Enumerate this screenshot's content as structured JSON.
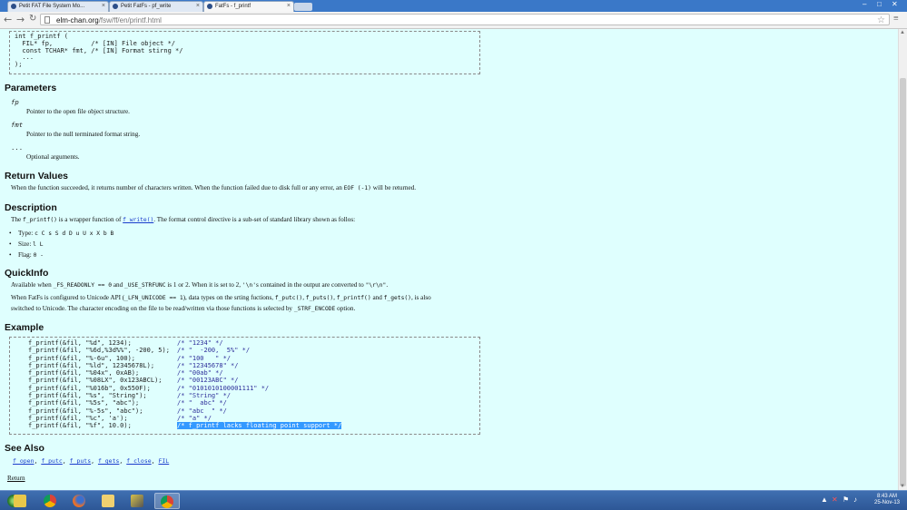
{
  "browser": {
    "tabs": [
      {
        "label": "Petit FAT File System Mo..."
      },
      {
        "label": "Petit FatFs - pf_write"
      },
      {
        "label": "FatFs - f_printf"
      }
    ],
    "url_host": "elm-chan.org",
    "url_path": "/fsw/ff/en/printf.html"
  },
  "prototype": {
    "lines": [
      "int f_printf (",
      "  FIL* fp,          /* [IN] File object */",
      "  const TCHAR* fmt, /* [IN] Format stirng */",
      "  ...",
      ");"
    ]
  },
  "parameters": {
    "heading": "Parameters",
    "items": [
      {
        "term": "fp",
        "desc": "Pointer to the open file object structure."
      },
      {
        "term": "fmt",
        "desc": "Pointer to the null terminated format string."
      },
      {
        "term": "...",
        "desc": "Optional arguments."
      }
    ]
  },
  "return_values": {
    "heading": "Return Values",
    "text_a": "When the function succeeded, it returns number of characters written. When the function failed due to disk full or any error, an",
    "code": "EOF (-1)",
    "text_b": "will be returned."
  },
  "description": {
    "heading": "Description",
    "text_a": "The",
    "code_a": "f_printf()",
    "text_b": "is a wrapper function of",
    "link": "f_write()",
    "text_c": ". The format control directive is a sub-set of standard library shown as follos:",
    "bullets": [
      {
        "label": "Type:",
        "value": "c C s S d D u U x X b B"
      },
      {
        "label": "Size:",
        "value": "l L"
      },
      {
        "label": "Flag:",
        "value": "0 -"
      }
    ]
  },
  "quickinfo": {
    "heading": "QuickInfo",
    "l1": [
      "Available when",
      "_FS_READONLY == 0",
      "and",
      "_USE_STRFUNC",
      "is 1 or 2. When it is set to 2,",
      "'\\n'",
      "s contained in the output are converted to",
      "\"\\r\\n\"",
      "."
    ],
    "l2": [
      "When FatFs is configured to Unicode API (",
      "_LFN_UNICODE == 1",
      "), data types on the srting fuctions,",
      "f_putc()",
      ",",
      "f_puts()",
      ",",
      "f_printf()",
      "and",
      "f_gets()",
      ", is also"
    ],
    "l3": [
      "switched to Unicode. The character encoding on the file to be read/written via those functions is selected by",
      "_STRF_ENCODE",
      "option."
    ]
  },
  "example": {
    "heading": "Example",
    "rows": [
      {
        "code": "f_printf(&fil, \"%d\", 1234);",
        "comment": "/* \"1234\" */"
      },
      {
        "code": "f_printf(&fil, \"%6d,%3d%%\", -200, 5);",
        "comment": "/* \"  -200,  5%\" */"
      },
      {
        "code": "f_printf(&fil, \"%-6u\", 100);",
        "comment": "/* \"100   \" */"
      },
      {
        "code": "f_printf(&fil, \"%ld\", 12345678L);",
        "comment": "/* \"12345678\" */"
      },
      {
        "code": "f_printf(&fil, \"%04x\", 0xAB);",
        "comment": "/* \"00ab\" */"
      },
      {
        "code": "f_printf(&fil, \"%08LX\", 0x123ABCL);",
        "comment": "/* \"00123ABC\" */"
      },
      {
        "code": "f_printf(&fil, \"%016b\", 0x550F);",
        "comment": "/* \"0101010100001111\" */"
      },
      {
        "code": "f_printf(&fil, \"%s\", \"String\");",
        "comment": "/* \"String\" */"
      },
      {
        "code": "f_printf(&fil, \"%5s\", \"abc\");",
        "comment": "/* \"  abc\" */"
      },
      {
        "code": "f_printf(&fil, \"%-5s\", \"abc\");",
        "comment": "/* \"abc  \" */"
      },
      {
        "code": "f_printf(&fil, \"%c\", 'a');",
        "comment": "/* \"a\" */"
      },
      {
        "code": "f_printf(&fil, \"%f\", 10.0);",
        "comment": "/* f_printf lacks floating point support */"
      }
    ]
  },
  "see_also": {
    "heading": "See Also",
    "links": [
      "f_open",
      "f_putc",
      "f_puts",
      "f_gets",
      "f_close",
      "FIL"
    ]
  },
  "return_link": "Return",
  "taskbar": {
    "time": "8:43 AM",
    "date": "25-Nov-13"
  }
}
